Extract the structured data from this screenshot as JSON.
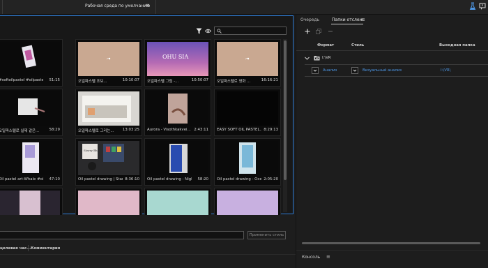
{
  "app": {
    "workspace_title": "Рабочая среда по умолчанию",
    "workspace_menu": "≡"
  },
  "media_browser": {
    "search": {
      "value": "",
      "placeholder": ""
    },
    "tiles": [
      {
        "name": "#softoilpastel #oilpastel #...",
        "duration": "51:15",
        "thumb": "phone"
      },
      {
        "name": "오일파스텔 조보...",
        "duration": "10:10:07",
        "thumb": "beige"
      },
      {
        "name": "오일파스텔 그림 -...",
        "duration": "10:50:07",
        "thumb": "purple",
        "overlay": "OHU SIA"
      },
      {
        "name": "오일파스텔로 영화 ...",
        "duration": "16:16:21",
        "thumb": "beige"
      },
      {
        "name": "오일파스텔로 실제 같은...",
        "duration": "58:29",
        "thumb": "drawing"
      },
      {
        "name": "오일파스텔로 그리는...",
        "duration": "13:03:25",
        "thumb": "box"
      },
      {
        "name": "Aurora - Visothkakvei...",
        "duration": "2:43:11",
        "thumb": "hand"
      },
      {
        "name": "EASY SOFT OIL PASTEL...",
        "duration": "8:29:13",
        "thumb": "black"
      },
      {
        "name": "Oil pastel art-Whale #oilp...",
        "duration": "47:10",
        "thumb": "paper"
      },
      {
        "name": "Oil pastel drawing | Star...",
        "duration": "8:36:10",
        "thumb": "desk",
        "overlay": "Starry Blue"
      },
      {
        "name": "Oil pastel drawing - Night...",
        "duration": "58:20",
        "thumb": "bluehand"
      },
      {
        "name": "Oil pastel drawing - Ocea...",
        "duration": "2:05:20",
        "thumb": "ocean"
      },
      {
        "name": "",
        "duration": "",
        "thumb": "pinkdark"
      },
      {
        "name": "",
        "duration": "",
        "thumb": "pink"
      },
      {
        "name": "",
        "duration": "",
        "thumb": "teal"
      },
      {
        "name": "",
        "duration": "",
        "thumb": "lavender"
      }
    ]
  },
  "styles_bar": {
    "input_value": "",
    "apply_label": "Применить стиль"
  },
  "bottom_columns": {
    "col1": "целевая час...",
    "col2": "Комментария"
  },
  "right_panel": {
    "tabs": [
      {
        "label": "Очередь",
        "active": false
      },
      {
        "label": "Папки отслеж.",
        "active": true
      }
    ],
    "tab_menu": "≡",
    "headers": {
      "format": "Формат",
      "style": "Стиль",
      "output": "Выходная папка"
    },
    "folder": {
      "name": "I:\\VR"
    },
    "preset": {
      "format": "Анализ",
      "style": "Визуальный анализ",
      "output": "I:\\VR\\"
    },
    "console": {
      "title": "Консоль",
      "menu": "≡"
    }
  },
  "colors": {
    "accent": "#2d7bd6",
    "link": "#4d97e6"
  }
}
